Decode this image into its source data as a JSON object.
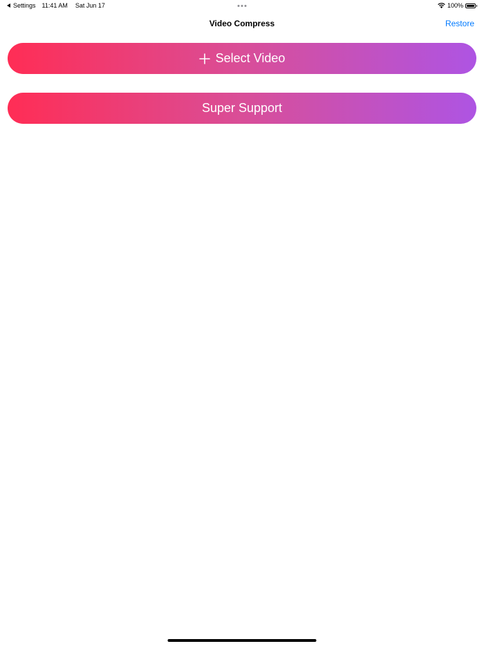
{
  "status_bar": {
    "back_label": "Settings",
    "time": "11:41 AM",
    "date": "Sat Jun 17",
    "battery": "100%"
  },
  "nav": {
    "title": "Video Compress",
    "restore_label": "Restore"
  },
  "buttons": {
    "select_video_label": "Select Video",
    "super_support_label": "Super Support"
  },
  "icons": {
    "back": "back-triangle-icon",
    "wifi": "wifi-icon",
    "battery": "battery-icon",
    "plus": "plus-icon"
  },
  "colors": {
    "gradient_start": "#ff2d55",
    "gradient_mid": "#d94e98",
    "gradient_end": "#ae54e3",
    "link": "#007aff"
  }
}
